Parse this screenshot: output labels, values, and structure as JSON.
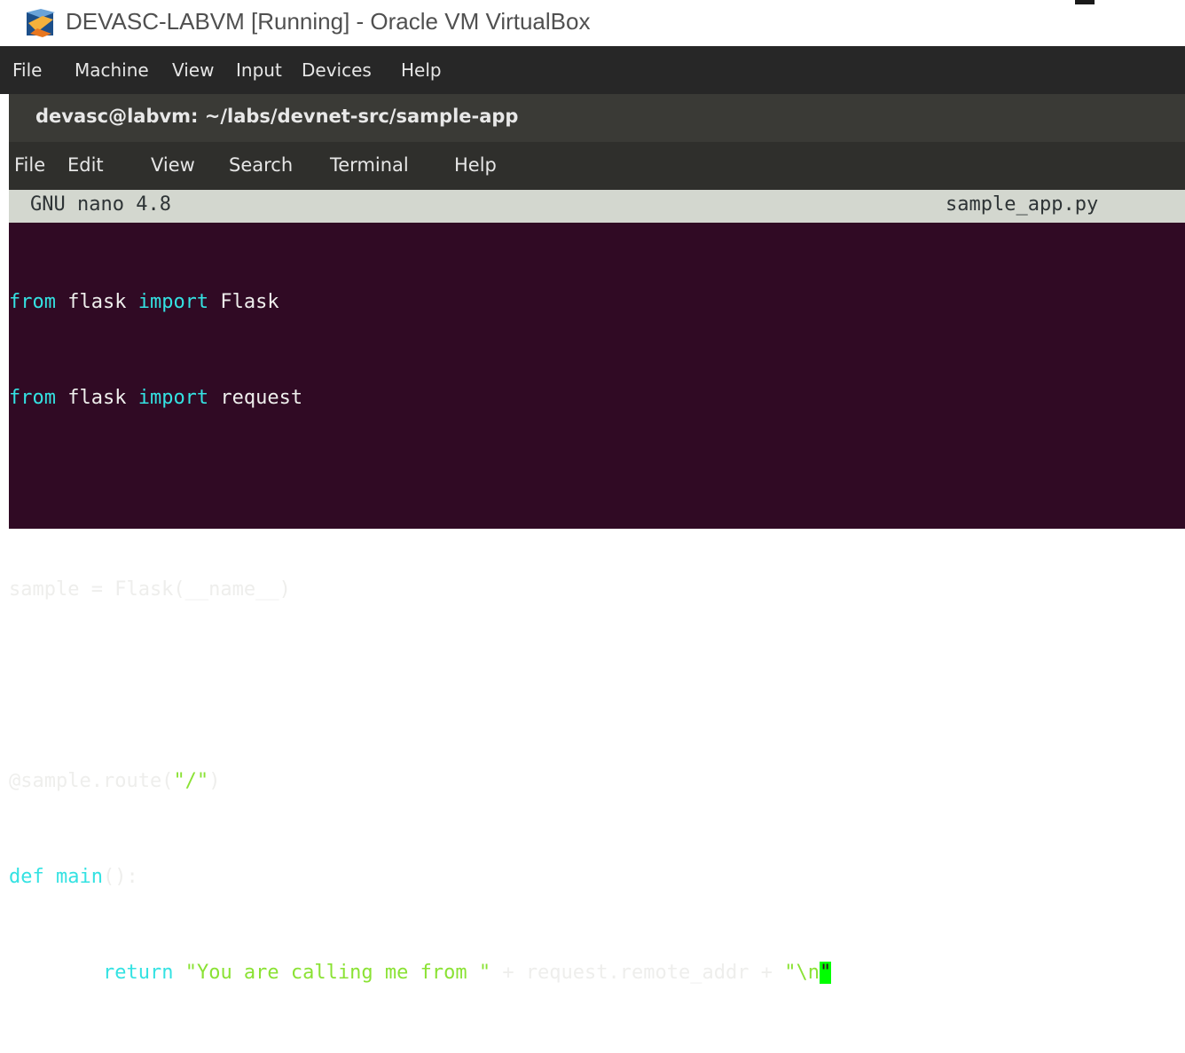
{
  "vbox": {
    "title": "DEVASC-LABVM [Running] - Oracle VM VirtualBox",
    "menu": [
      "File",
      "Machine",
      "View",
      "Input",
      "Devices",
      "Help"
    ]
  },
  "terminal": {
    "title": "devasc@labvm: ~/labs/devnet-src/sample-app",
    "menu": [
      "File",
      "Edit",
      "View",
      "Search",
      "Terminal",
      "Help"
    ]
  },
  "nano": {
    "version": "GNU nano 4.8",
    "filename": "sample_app.py"
  },
  "code": {
    "l1_kw1": "from",
    "l1_mid": " flask ",
    "l1_kw2": "import",
    "l1_end": " Flask",
    "l2_kw1": "from",
    "l2_mid": " flask ",
    "l2_kw2": "import",
    "l2_end": " request",
    "l4": "sample = Flask(__name__)",
    "l6_start": "@sample.route(",
    "l6_str": "\"/\"",
    "l6_end": ")",
    "l7_kw": "def",
    "l7_sp": " ",
    "l7_fn": "main",
    "l7_end": "():",
    "l8_indent": "        ",
    "l8_kw": "return",
    "l8_sp": " ",
    "l8_str1": "\"You are calling me from \"",
    "l8_mid": " + request.remote_addr + ",
    "l8_str2": "\"\\n",
    "l8_cursor": "\""
  },
  "colors": {
    "terminal_bg": "#300a24",
    "keyword": "#34e2e2",
    "string": "#8ae234",
    "cursor": "#00ff00"
  },
  "icons": {
    "app_icon": "virtualbox-logo-icon"
  }
}
